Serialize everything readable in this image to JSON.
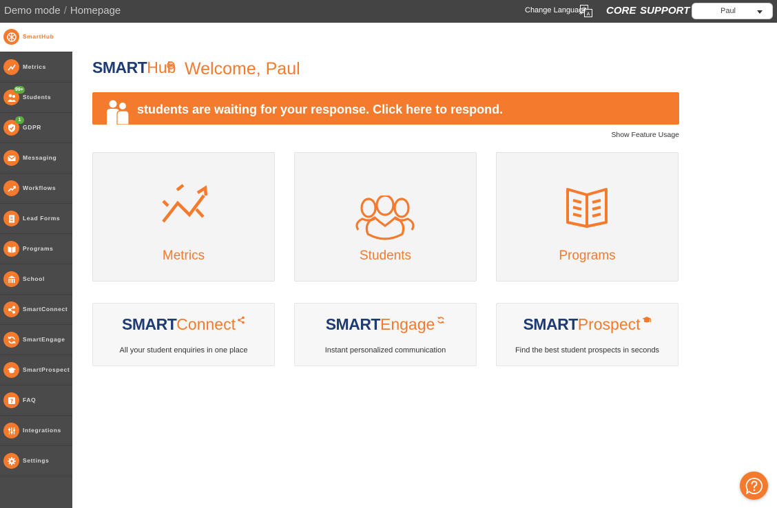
{
  "topbar": {
    "crumb_root": "Demo mode",
    "crumb_sep": "/",
    "crumb_page": "Homepage",
    "change_language": "Change Language",
    "core": "CORE",
    "support": "SUPPORT",
    "user": "Paul"
  },
  "sidebar": {
    "items": [
      {
        "label": "SmartHub",
        "icon": "smarthub-icon",
        "active": true
      },
      {
        "label": "Metrics",
        "icon": "metrics-icon"
      },
      {
        "label": "Students",
        "icon": "students-icon",
        "badge": "99+"
      },
      {
        "label": "GDPR",
        "icon": "gdpr-icon",
        "badge": "1"
      },
      {
        "label": "Messaging",
        "icon": "messaging-icon"
      },
      {
        "label": "Workflows",
        "icon": "workflows-icon"
      },
      {
        "label": "Lead Forms",
        "icon": "lead-forms-icon"
      },
      {
        "label": "Programs",
        "icon": "programs-icon"
      },
      {
        "label": "School",
        "icon": "school-icon"
      },
      {
        "label": "SmartConnect",
        "icon": "smartconnect-icon"
      },
      {
        "label": "SmartEngage",
        "icon": "smartengage-icon"
      },
      {
        "label": "SmartProspect",
        "icon": "smartprospect-icon"
      },
      {
        "label": "FAQ",
        "icon": "faq-icon"
      },
      {
        "label": "Integrations",
        "icon": "integrations-icon"
      },
      {
        "label": "Settings",
        "icon": "settings-icon"
      }
    ]
  },
  "main": {
    "brand_smart": "SMART",
    "brand_hub": "Hub",
    "welcome": "Welcome, Paul",
    "banner": "students are waiting for your response. Click here to respond.",
    "feature_usage": "Show Feature Usage",
    "cards": [
      {
        "label": "Metrics",
        "icon": "metrics-chart-icon"
      },
      {
        "label": "Students",
        "icon": "students-group-icon"
      },
      {
        "label": "Programs",
        "icon": "open-book-icon"
      }
    ],
    "products": [
      {
        "smart": "SMART",
        "name": "Connect",
        "desc": "All your student enquiries in one place",
        "icon": "share-icon"
      },
      {
        "smart": "SMART",
        "name": "Engage",
        "desc": "Instant personalized communication",
        "icon": "refresh-icon"
      },
      {
        "smart": "SMART",
        "name": "Prospect",
        "desc": "Find the best student prospects in seconds",
        "icon": "graduation-cap-icon"
      }
    ]
  },
  "colors": {
    "accent": "#f47a2e",
    "brand_navy": "#1f3b73",
    "topbar": "#444444",
    "sidebar": "#4a4a4a",
    "badge": "#5aab3d"
  }
}
